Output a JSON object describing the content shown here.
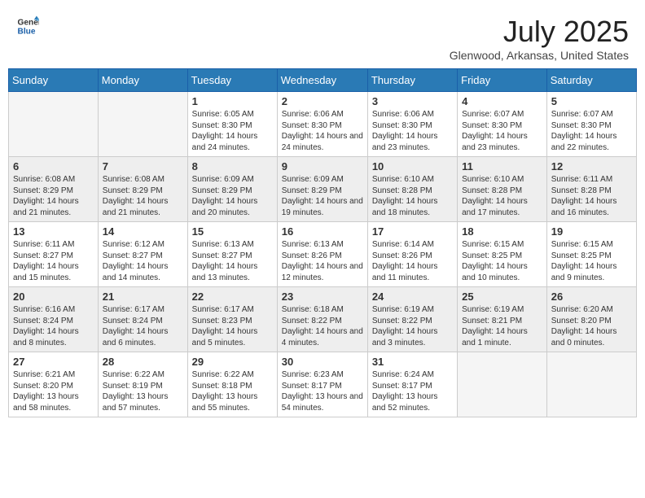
{
  "header": {
    "logo_general": "General",
    "logo_blue": "Blue",
    "title": "July 2025",
    "subtitle": "Glenwood, Arkansas, United States"
  },
  "weekdays": [
    "Sunday",
    "Monday",
    "Tuesday",
    "Wednesday",
    "Thursday",
    "Friday",
    "Saturday"
  ],
  "weeks": [
    [
      {
        "day": "",
        "info": ""
      },
      {
        "day": "",
        "info": ""
      },
      {
        "day": "1",
        "info": "Sunrise: 6:05 AM\nSunset: 8:30 PM\nDaylight: 14 hours and 24 minutes."
      },
      {
        "day": "2",
        "info": "Sunrise: 6:06 AM\nSunset: 8:30 PM\nDaylight: 14 hours and 24 minutes."
      },
      {
        "day": "3",
        "info": "Sunrise: 6:06 AM\nSunset: 8:30 PM\nDaylight: 14 hours and 23 minutes."
      },
      {
        "day": "4",
        "info": "Sunrise: 6:07 AM\nSunset: 8:30 PM\nDaylight: 14 hours and 23 minutes."
      },
      {
        "day": "5",
        "info": "Sunrise: 6:07 AM\nSunset: 8:30 PM\nDaylight: 14 hours and 22 minutes."
      }
    ],
    [
      {
        "day": "6",
        "info": "Sunrise: 6:08 AM\nSunset: 8:29 PM\nDaylight: 14 hours and 21 minutes."
      },
      {
        "day": "7",
        "info": "Sunrise: 6:08 AM\nSunset: 8:29 PM\nDaylight: 14 hours and 21 minutes."
      },
      {
        "day": "8",
        "info": "Sunrise: 6:09 AM\nSunset: 8:29 PM\nDaylight: 14 hours and 20 minutes."
      },
      {
        "day": "9",
        "info": "Sunrise: 6:09 AM\nSunset: 8:29 PM\nDaylight: 14 hours and 19 minutes."
      },
      {
        "day": "10",
        "info": "Sunrise: 6:10 AM\nSunset: 8:28 PM\nDaylight: 14 hours and 18 minutes."
      },
      {
        "day": "11",
        "info": "Sunrise: 6:10 AM\nSunset: 8:28 PM\nDaylight: 14 hours and 17 minutes."
      },
      {
        "day": "12",
        "info": "Sunrise: 6:11 AM\nSunset: 8:28 PM\nDaylight: 14 hours and 16 minutes."
      }
    ],
    [
      {
        "day": "13",
        "info": "Sunrise: 6:11 AM\nSunset: 8:27 PM\nDaylight: 14 hours and 15 minutes."
      },
      {
        "day": "14",
        "info": "Sunrise: 6:12 AM\nSunset: 8:27 PM\nDaylight: 14 hours and 14 minutes."
      },
      {
        "day": "15",
        "info": "Sunrise: 6:13 AM\nSunset: 8:27 PM\nDaylight: 14 hours and 13 minutes."
      },
      {
        "day": "16",
        "info": "Sunrise: 6:13 AM\nSunset: 8:26 PM\nDaylight: 14 hours and 12 minutes."
      },
      {
        "day": "17",
        "info": "Sunrise: 6:14 AM\nSunset: 8:26 PM\nDaylight: 14 hours and 11 minutes."
      },
      {
        "day": "18",
        "info": "Sunrise: 6:15 AM\nSunset: 8:25 PM\nDaylight: 14 hours and 10 minutes."
      },
      {
        "day": "19",
        "info": "Sunrise: 6:15 AM\nSunset: 8:25 PM\nDaylight: 14 hours and 9 minutes."
      }
    ],
    [
      {
        "day": "20",
        "info": "Sunrise: 6:16 AM\nSunset: 8:24 PM\nDaylight: 14 hours and 8 minutes."
      },
      {
        "day": "21",
        "info": "Sunrise: 6:17 AM\nSunset: 8:24 PM\nDaylight: 14 hours and 6 minutes."
      },
      {
        "day": "22",
        "info": "Sunrise: 6:17 AM\nSunset: 8:23 PM\nDaylight: 14 hours and 5 minutes."
      },
      {
        "day": "23",
        "info": "Sunrise: 6:18 AM\nSunset: 8:22 PM\nDaylight: 14 hours and 4 minutes."
      },
      {
        "day": "24",
        "info": "Sunrise: 6:19 AM\nSunset: 8:22 PM\nDaylight: 14 hours and 3 minutes."
      },
      {
        "day": "25",
        "info": "Sunrise: 6:19 AM\nSunset: 8:21 PM\nDaylight: 14 hours and 1 minute."
      },
      {
        "day": "26",
        "info": "Sunrise: 6:20 AM\nSunset: 8:20 PM\nDaylight: 14 hours and 0 minutes."
      }
    ],
    [
      {
        "day": "27",
        "info": "Sunrise: 6:21 AM\nSunset: 8:20 PM\nDaylight: 13 hours and 58 minutes."
      },
      {
        "day": "28",
        "info": "Sunrise: 6:22 AM\nSunset: 8:19 PM\nDaylight: 13 hours and 57 minutes."
      },
      {
        "day": "29",
        "info": "Sunrise: 6:22 AM\nSunset: 8:18 PM\nDaylight: 13 hours and 55 minutes."
      },
      {
        "day": "30",
        "info": "Sunrise: 6:23 AM\nSunset: 8:17 PM\nDaylight: 13 hours and 54 minutes."
      },
      {
        "day": "31",
        "info": "Sunrise: 6:24 AM\nSunset: 8:17 PM\nDaylight: 13 hours and 52 minutes."
      },
      {
        "day": "",
        "info": ""
      },
      {
        "day": "",
        "info": ""
      }
    ]
  ]
}
